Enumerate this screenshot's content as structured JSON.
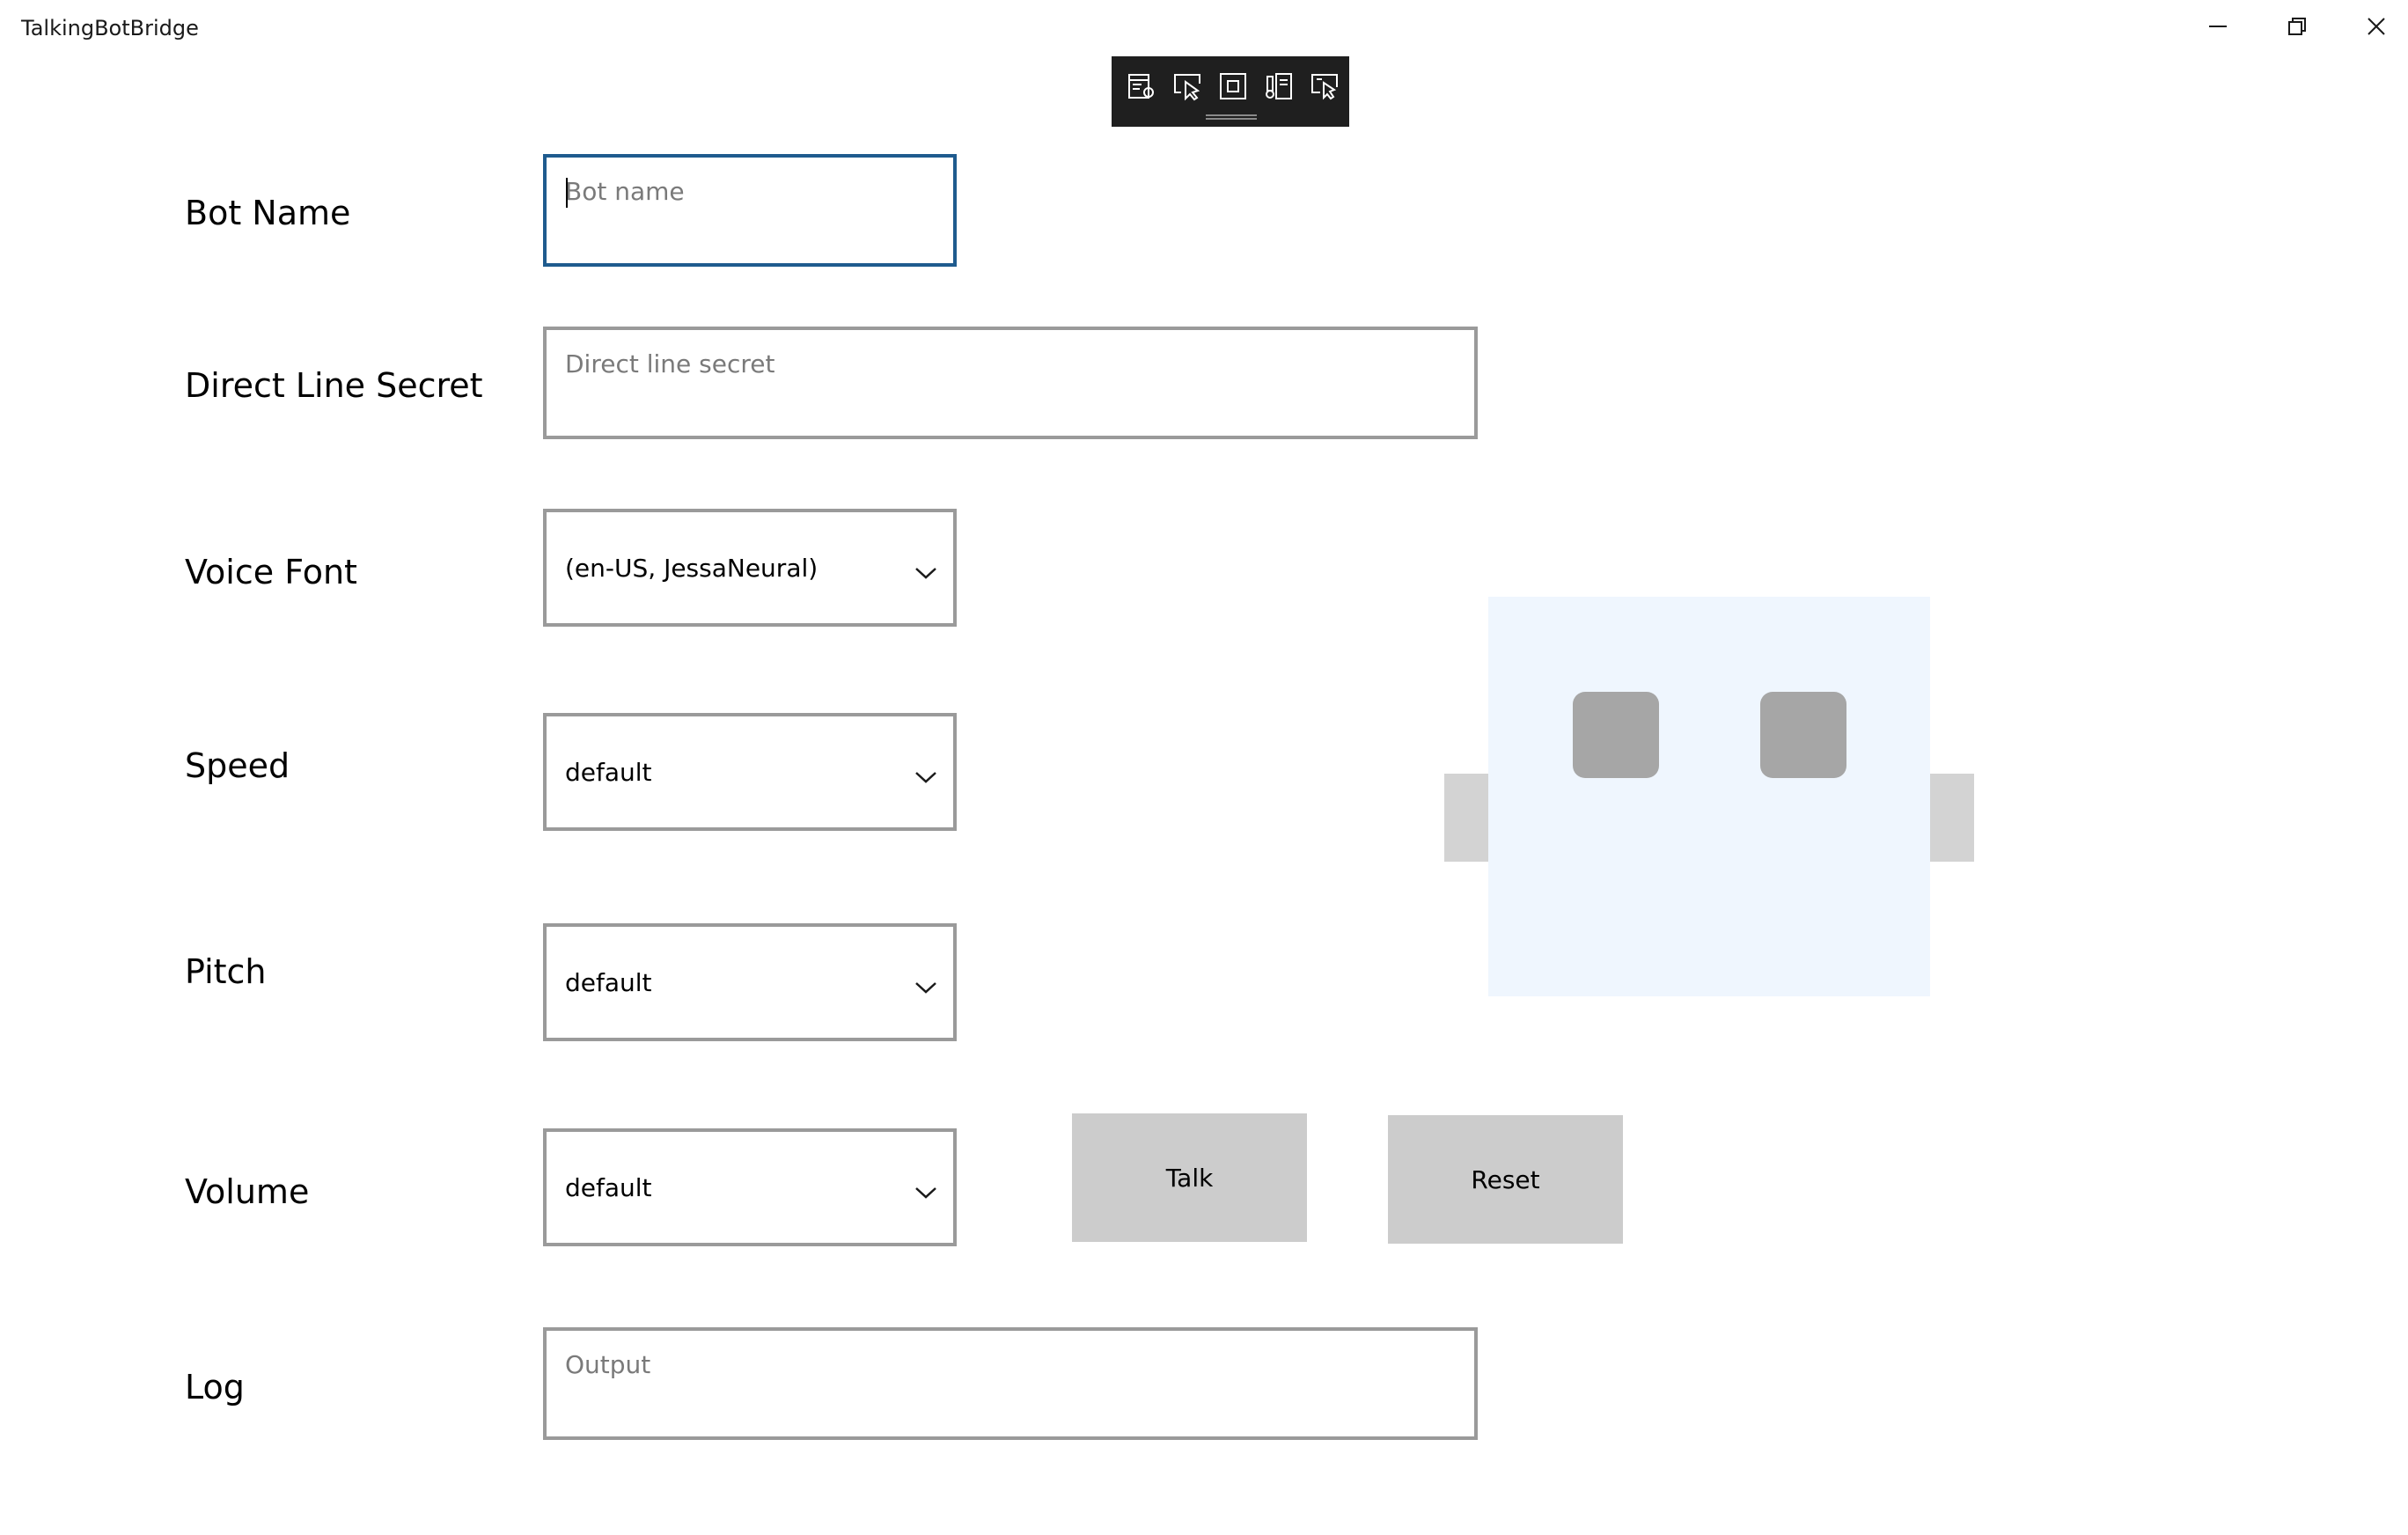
{
  "window": {
    "title": "TalkingBotBridge",
    "controls": [
      "minimize-icon",
      "restore-icon",
      "close-icon"
    ]
  },
  "debug_toolbar": {
    "icons": [
      "live-visual-tree-icon",
      "select-element-icon",
      "display-layout-adorners-icon",
      "track-focused-element-icon",
      "preview-selection-icon"
    ]
  },
  "form": {
    "bot_name": {
      "label": "Bot Name",
      "placeholder": "Bot name",
      "value": ""
    },
    "direct_line_secret": {
      "label": "Direct Line Secret",
      "placeholder": "Direct line secret",
      "value": ""
    },
    "voice_font": {
      "label": "Voice Font",
      "selected": "(en-US, JessaNeural)"
    },
    "speed": {
      "label": "Speed",
      "selected": "default"
    },
    "pitch": {
      "label": "Pitch",
      "selected": "default"
    },
    "volume": {
      "label": "Volume",
      "selected": "default"
    },
    "log": {
      "label": "Log",
      "placeholder": "Output",
      "value": ""
    }
  },
  "actions": {
    "talk_label": "Talk",
    "reset_label": "Reset"
  },
  "colors": {
    "focus_border": "#1f5b8e",
    "field_border": "#9a9a9a",
    "button_bg": "#cccccc",
    "robot_face": "#eff6fe",
    "robot_eye": "#a6a6a6",
    "robot_ear": "#d3d3d3",
    "toolbar_bg": "#1f1f1f"
  }
}
